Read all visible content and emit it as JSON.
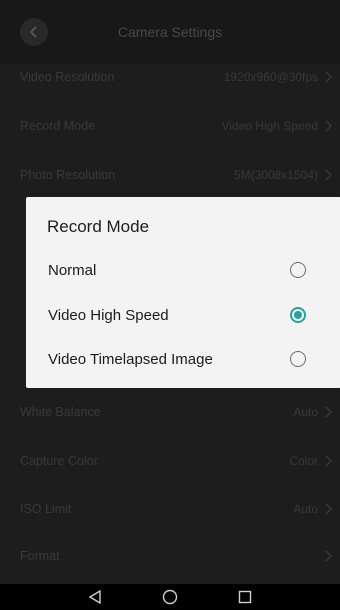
{
  "header": {
    "title": "Camera Settings"
  },
  "settings": [
    {
      "label": "Video Resolution",
      "value": "1920x960@30fps"
    },
    {
      "label": "Record Mode",
      "value": "Video High Speed"
    },
    {
      "label": "Photo Resolution",
      "value": "5M(3008x1504)"
    },
    {
      "label": "White Balance",
      "value": "Auto"
    },
    {
      "label": "Capture Color",
      "value": "Color"
    },
    {
      "label": "ISO Limit",
      "value": "Auto"
    },
    {
      "label": "Format",
      "value": ""
    }
  ],
  "dialog": {
    "title": "Record Mode",
    "options": [
      {
        "label": "Normal",
        "selected": false
      },
      {
        "label": "Video High Speed",
        "selected": true
      },
      {
        "label": "Video Timelapsed Image",
        "selected": false
      }
    ]
  },
  "colors": {
    "accent": "#23a3a0",
    "dialog_bg": "#f3f3f3",
    "screen_bg": "#2d2d2d"
  },
  "icons": {
    "back": "chevron-left-icon",
    "row_chevron": "chevron-right-icon",
    "nav_back": "triangle-back-icon",
    "nav_home": "circle-home-icon",
    "nav_recents": "square-recents-icon"
  }
}
